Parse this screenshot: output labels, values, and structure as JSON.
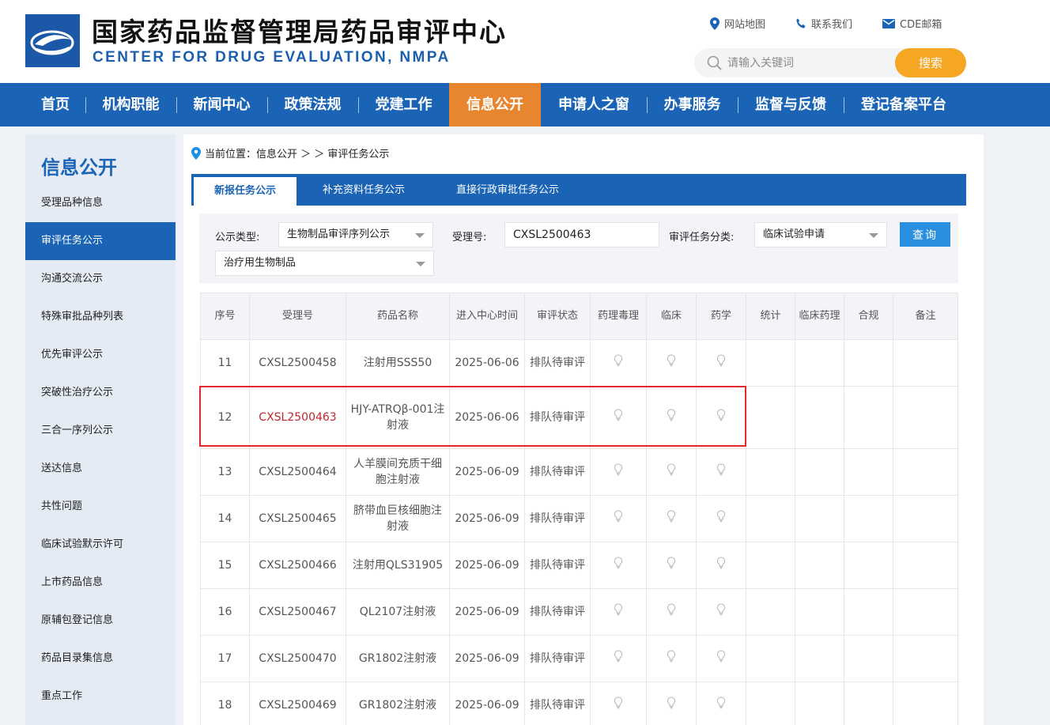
{
  "header": {
    "title_cn": "国家药品监督管理局药品审评中心",
    "title_en": "CENTER FOR DRUG EVALUATION, NMPA",
    "util_links": [
      {
        "label": "网站地图",
        "icon": "location-pin-icon"
      },
      {
        "label": "联系我们",
        "icon": "phone-icon"
      },
      {
        "label": "CDE邮箱",
        "icon": "mail-icon"
      }
    ],
    "search": {
      "placeholder": "请输入关键词",
      "button_label": "搜索"
    }
  },
  "nav": {
    "items": [
      "首页",
      "机构职能",
      "新闻中心",
      "政策法规",
      "党建工作",
      "信息公开",
      "申请人之窗",
      "办事服务",
      "监督与反馈",
      "登记备案平台"
    ],
    "active_index": 5
  },
  "sidebar": {
    "title": "信息公开",
    "items": [
      "受理品种信息",
      "审评任务公示",
      "沟通交流公示",
      "特殊审批品种列表",
      "优先审评公示",
      "突破性治疗公示",
      "三合一序列公示",
      "送达信息",
      "共性问题",
      "临床试验默示许可",
      "上市药品信息",
      "原辅包登记信息",
      "药品目录集信息",
      "重点工作"
    ],
    "active_index": 1
  },
  "breadcrumb": {
    "prefix": "当前位置：",
    "path": "信息公开 ＞ ＞ 审评任务公示"
  },
  "tabs": {
    "items": [
      "新报任务公示",
      "补充资料任务公示",
      "直接行政审批任务公示"
    ],
    "active_index": 0
  },
  "filters": {
    "type_label": "公示类型:",
    "type_value": "生物制品审评序列公示",
    "accept_label": "受理号:",
    "accept_value": "CXSL2500463",
    "category_label": "审评任务分类:",
    "category_value": "临床试验申请",
    "subtype_value": "治疗用生物制品",
    "query_label": "查询"
  },
  "table": {
    "headers": [
      "序号",
      "受理号",
      "药品名称",
      "进入中心时间",
      "审评状态",
      "药理毒理",
      "临床",
      "药学",
      "统计",
      "临床药理",
      "合规",
      "备注"
    ],
    "rows": [
      {
        "no": "11",
        "id": "CXSL2500458",
        "name": "注射用SSS50",
        "date": "2025-06-06",
        "status": "排队待审评"
      },
      {
        "no": "12",
        "id": "CXSL2500463",
        "name": "HJY-ATRQβ-001注射液",
        "date": "2025-06-06",
        "status": "排队待审评"
      },
      {
        "no": "13",
        "id": "CXSL2500464",
        "name": "人羊膜间充质干细胞注射液",
        "date": "2025-06-09",
        "status": "排队待审评"
      },
      {
        "no": "14",
        "id": "CXSL2500465",
        "name": "脐带血巨核细胞注射液",
        "date": "2025-06-09",
        "status": "排队待审评"
      },
      {
        "no": "15",
        "id": "CXSL2500466",
        "name": "注射用QLS31905",
        "date": "2025-06-09",
        "status": "排队待审评"
      },
      {
        "no": "16",
        "id": "CXSL2500467",
        "name": "QL2107注射液",
        "date": "2025-06-09",
        "status": "排队待审评"
      },
      {
        "no": "17",
        "id": "CXSL2500470",
        "name": "GR1802注射液",
        "date": "2025-06-09",
        "status": "排队待审评"
      },
      {
        "no": "18",
        "id": "CXSL2500469",
        "name": "GR1802注射液",
        "date": "2025-06-09",
        "status": "排队待审评"
      }
    ],
    "highlighted_row": 1
  },
  "colors": {
    "brand_blue": "#1b64b5",
    "nav_active": "#e8852f",
    "search_btn": "#f5a623",
    "highlight": "#e0282e"
  }
}
